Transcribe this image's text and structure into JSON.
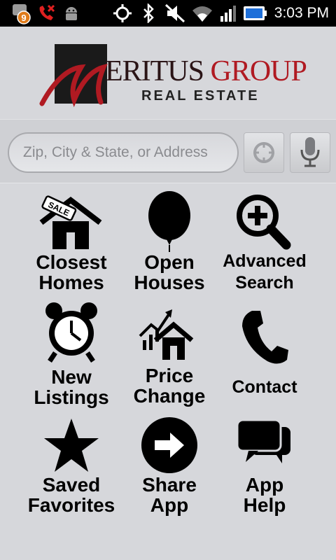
{
  "status_bar": {
    "time": "3:03 PM",
    "notification_count": "9",
    "icons": [
      "notification-badge-icon",
      "missed-call-icon",
      "android-debug-icon",
      "gps-icon",
      "bluetooth-icon",
      "muted-icon",
      "wifi-icon",
      "signal-icon",
      "battery-icon"
    ]
  },
  "logo": {
    "brand_first": "M",
    "brand_rest": "ERITUS",
    "brand_group": "GROUP",
    "subtitle": "REAL ESTATE"
  },
  "search": {
    "placeholder": "Zip, City & State, or Address",
    "location_icon": "crosshair-icon",
    "voice_icon": "microphone-icon"
  },
  "menu": [
    {
      "label": "Closest\nHomes",
      "icon": "sale-house-icon"
    },
    {
      "label": "Open\nHouses",
      "icon": "balloon-icon"
    },
    {
      "label": "Advanced\nSearch",
      "icon": "magnifier-plus-icon"
    },
    {
      "label": "New\nListings",
      "icon": "alarm-clock-icon"
    },
    {
      "label": "Price\nChange",
      "icon": "chart-house-icon"
    },
    {
      "label": "Contact",
      "icon": "phone-icon"
    },
    {
      "label": "Saved\nFavorites",
      "icon": "star-icon"
    },
    {
      "label": "Share\nApp",
      "icon": "arrow-circle-icon"
    },
    {
      "label": "App\nHelp",
      "icon": "chat-bubbles-icon"
    }
  ],
  "colors": {
    "brand_red": "#b01a22",
    "background": "#d6d7db"
  }
}
